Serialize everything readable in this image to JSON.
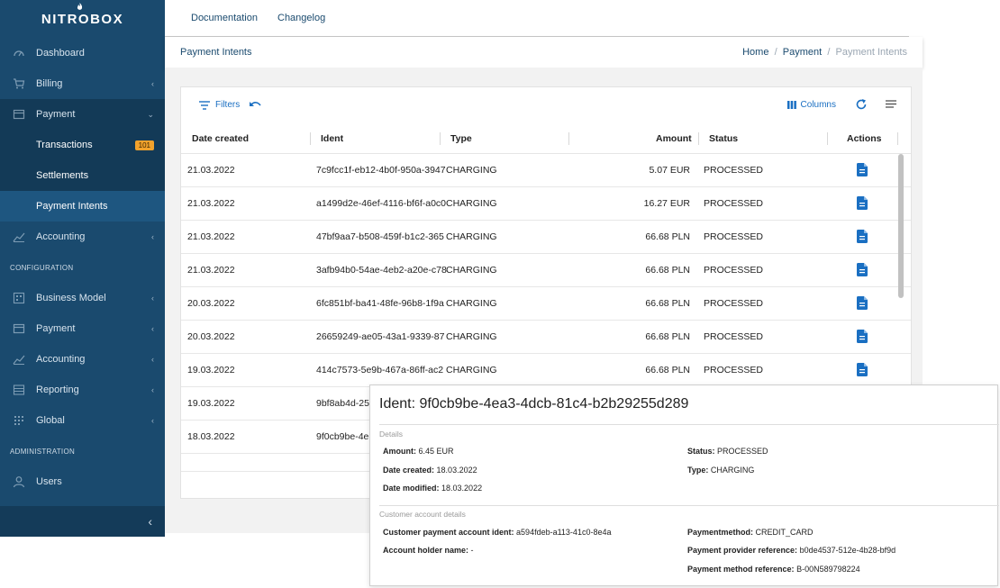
{
  "brand": {
    "logo": "NITROBOX"
  },
  "sidebar": {
    "items": [
      {
        "label": "Dashboard"
      },
      {
        "label": "Billing"
      },
      {
        "label": "Payment"
      },
      {
        "label": "Transactions",
        "badge": "101"
      },
      {
        "label": "Settlements"
      },
      {
        "label": "Payment Intents"
      },
      {
        "label": "Accounting"
      }
    ],
    "config_heading": "CONFIGURATION",
    "config_items": [
      {
        "label": "Business Model"
      },
      {
        "label": "Payment"
      },
      {
        "label": "Accounting"
      },
      {
        "label": "Reporting"
      },
      {
        "label": "Global"
      }
    ],
    "admin_heading": "ADMINISTRATION",
    "admin_items": [
      {
        "label": "Users"
      }
    ],
    "collapse_glyph": "‹"
  },
  "topnav": {
    "documentation": "Documentation",
    "changelog": "Changelog"
  },
  "header": {
    "title": "Payment Intents",
    "breadcrumb": {
      "home": "Home",
      "payment": "Payment",
      "current": "Payment Intents",
      "sep": "/"
    }
  },
  "toolbar": {
    "filters": "Filters",
    "columns": "Columns"
  },
  "table": {
    "headers": {
      "date": "Date created",
      "ident": "Ident",
      "type": "Type",
      "amount": "Amount",
      "status": "Status",
      "actions": "Actions"
    },
    "rows": [
      {
        "date": "21.03.2022",
        "ident": "7c9fcc1f-eb12-4b0f-950a-3947",
        "type": "CHARGING",
        "amount": "5.07 EUR",
        "status": "PROCESSED"
      },
      {
        "date": "21.03.2022",
        "ident": "a1499d2e-46ef-4116-bf6f-a0c0",
        "type": "CHARGING",
        "amount": "16.27 EUR",
        "status": "PROCESSED"
      },
      {
        "date": "21.03.2022",
        "ident": "47bf9aa7-b508-459f-b1c2-365",
        "type": "CHARGING",
        "amount": "66.68 PLN",
        "status": "PROCESSED"
      },
      {
        "date": "21.03.2022",
        "ident": "3afb94b0-54ae-4eb2-a20e-c78",
        "type": "CHARGING",
        "amount": "66.68 PLN",
        "status": "PROCESSED"
      },
      {
        "date": "20.03.2022",
        "ident": "6fc851bf-ba41-48fe-96b8-1f9a",
        "type": "CHARGING",
        "amount": "66.68 PLN",
        "status": "PROCESSED"
      },
      {
        "date": "20.03.2022",
        "ident": "26659249-ae05-43a1-9339-87",
        "type": "CHARGING",
        "amount": "66.68 PLN",
        "status": "PROCESSED"
      },
      {
        "date": "19.03.2022",
        "ident": "414c7573-5e9b-467a-86ff-ac2",
        "type": "CHARGING",
        "amount": "66.68 PLN",
        "status": "PROCESSED"
      },
      {
        "date": "19.03.2022",
        "ident": "9bf8ab4d-25"
      },
      {
        "date": "18.03.2022",
        "ident": "9f0cb9be-4e"
      }
    ]
  },
  "popover": {
    "title": "Ident: 9f0cb9be-4ea3-4dcb-81c4-b2b29255d289",
    "details_heading": "Details",
    "amount_label": "Amount:",
    "amount": "6.45 EUR",
    "status_label": "Status:",
    "status": "PROCESSED",
    "date_created_label": "Date created:",
    "date_created": "18.03.2022",
    "type_label": "Type:",
    "type": "CHARGING",
    "date_modified_label": "Date modified:",
    "date_modified": "18.03.2022",
    "customer_heading": "Customer account details",
    "cust_ident_label": "Customer payment account ident:",
    "cust_ident": "a594fdeb-a113-41c0-8e4a",
    "paymentmethod_label": "Paymentmethod:",
    "paymentmethod": "CREDIT_CARD",
    "holder_label": "Account holder name:",
    "holder": "-",
    "provider_ref_label": "Payment provider reference:",
    "provider_ref": "b0de4537-512e-4b28-bf9d",
    "method_ref_label": "Payment method reference:",
    "method_ref": "B-00N589798224"
  }
}
